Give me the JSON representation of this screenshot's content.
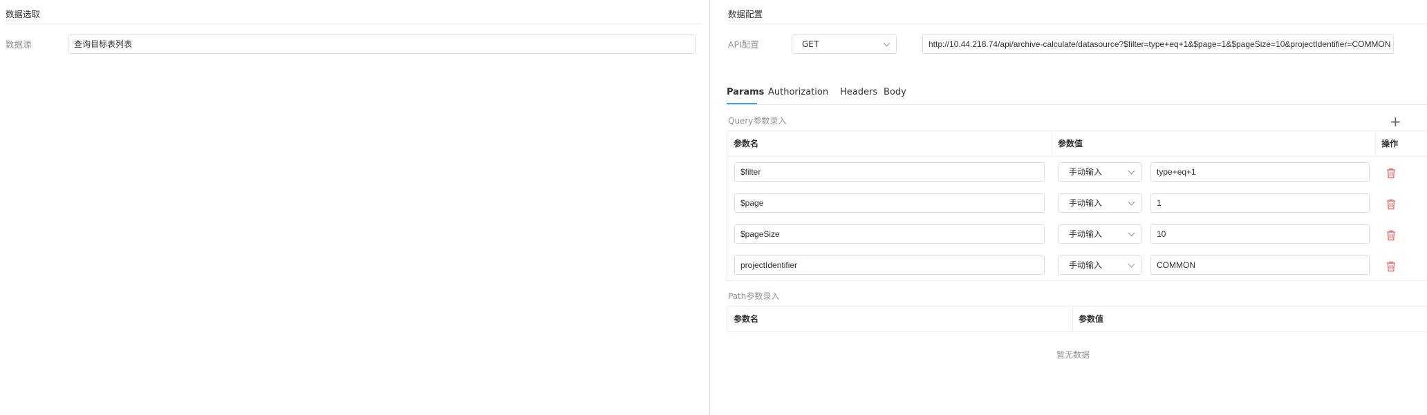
{
  "left": {
    "title": "数据选取",
    "datasource_label": "数据源",
    "datasource_value": "查询目标表列表"
  },
  "right": {
    "title": "数据配置",
    "api_label": "API配置",
    "method": "GET",
    "url": "http://10.44.218.74/api/archive-calculate/datasource?$filter=type+eq+1&$page=1&$pageSize=10&projectIdentifier=COMMON",
    "tabs": [
      {
        "label": "Params",
        "active": true
      },
      {
        "label": "Authorization",
        "active": false
      },
      {
        "label": "Headers",
        "active": false
      },
      {
        "label": "Body",
        "active": false
      }
    ],
    "query_title": "Query参数录入",
    "query_headers": {
      "name": "参数名",
      "value": "参数值",
      "action": "操作"
    },
    "query_rows": [
      {
        "name": "$filter",
        "source": "手动输入",
        "value": "type+eq+1"
      },
      {
        "name": "$page",
        "source": "手动输入",
        "value": "1"
      },
      {
        "name": "$pageSize",
        "source": "手动输入",
        "value": "10"
      },
      {
        "name": "projectIdentifier",
        "source": "手动输入",
        "value": "COMMON"
      }
    ],
    "path_title": "Path参数录入",
    "path_headers": {
      "name": "参数名",
      "value": "参数值"
    },
    "path_empty": "暂无数据"
  },
  "icons": {
    "delete": "trash-icon",
    "add": "plus-icon",
    "dropdown": "chevron-down-icon"
  },
  "colors": {
    "accent": "#409eff",
    "danger": "#f56c6c",
    "border": "#dcdfe6"
  }
}
